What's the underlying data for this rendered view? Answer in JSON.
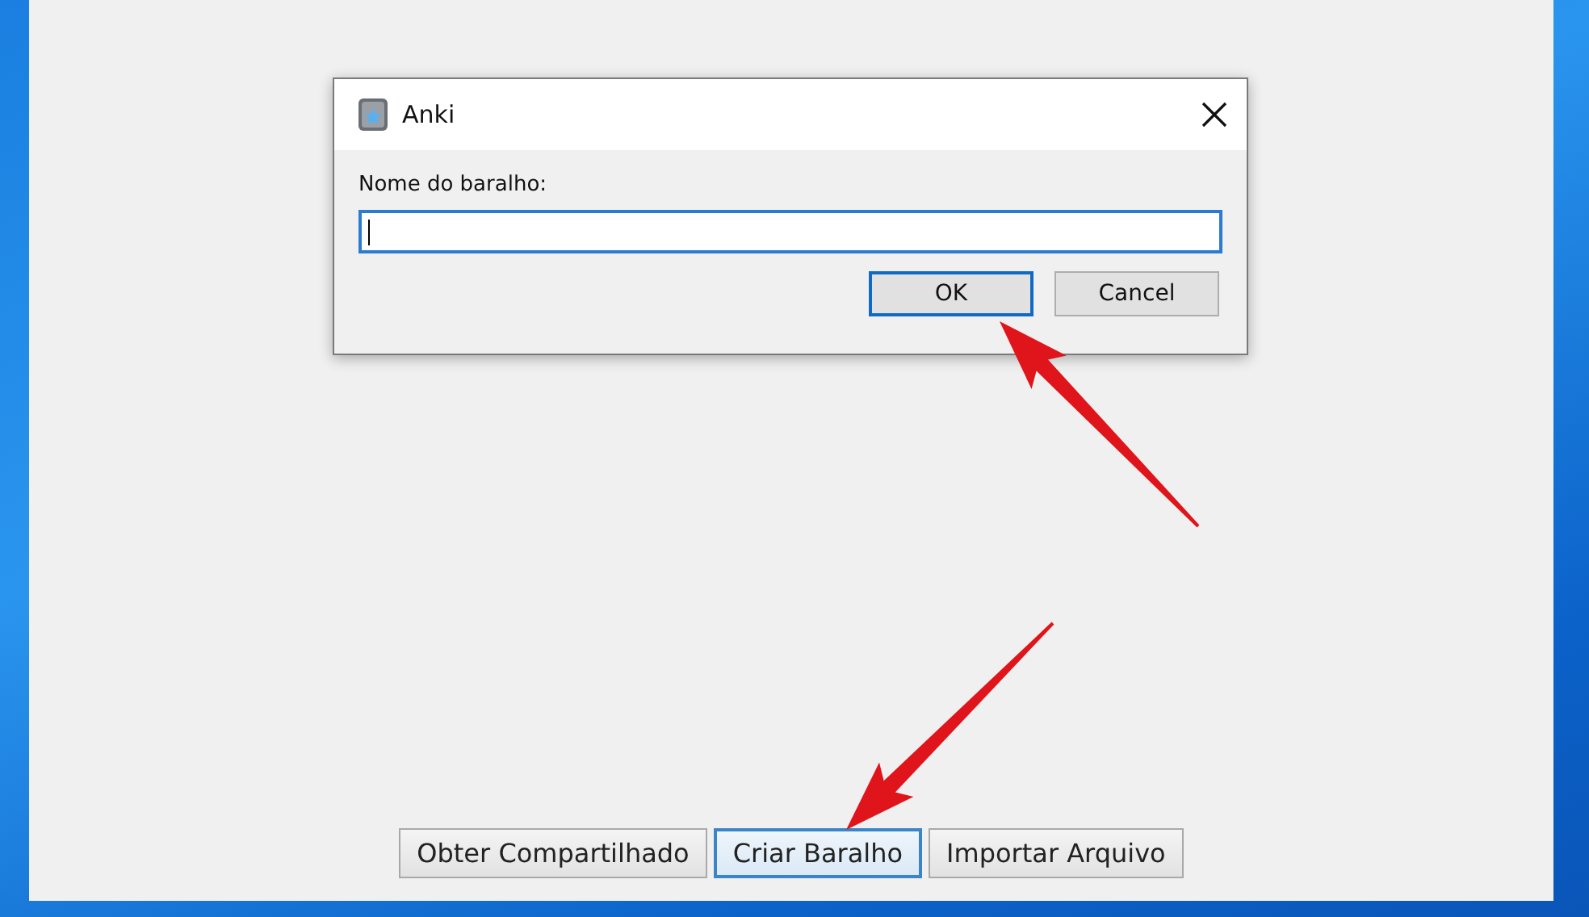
{
  "dialog": {
    "title": "Anki",
    "field": {
      "label": "Nome do baralho:",
      "focused": true
    },
    "buttons": [
      {
        "label": "OK",
        "focused": true
      },
      {
        "label": "Cancel",
        "focused": false
      }
    ]
  },
  "main_window": {
    "buttons": [
      {
        "label": "Obter Compartilhado",
        "focused": false
      },
      {
        "label": "Criar Baralho",
        "focused": true
      },
      {
        "label": "Importar Arquivo",
        "focused": false
      }
    ]
  }
}
